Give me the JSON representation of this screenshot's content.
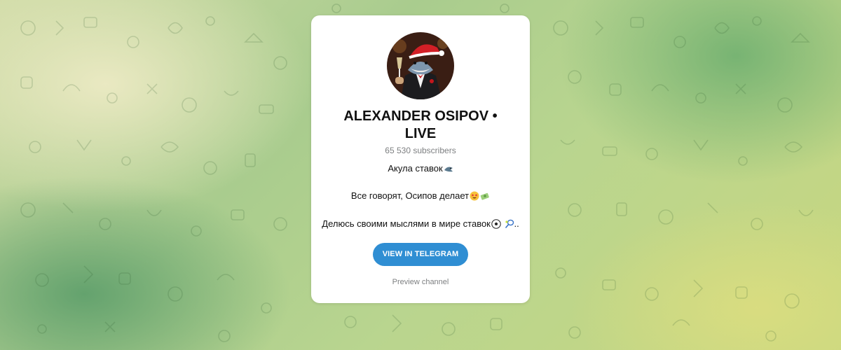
{
  "channel": {
    "title_line1": "ALEXANDER OSIPOV •",
    "title_line2": "LIVE",
    "subscribers": "65 530 subscribers",
    "description_line1": "Акула ставок",
    "description_line2": "Все говорят, Осипов делает",
    "description_line3": "Делюсь своими мыслями в мире ставок",
    "description_line3_suffix": ".."
  },
  "actions": {
    "view_button": "VIEW IN TELEGRAM",
    "preview_link": "Preview channel"
  },
  "icons": {
    "avatar": "shark-in-tuxedo-avatar",
    "d1": "shark-emoji",
    "d2a": "star-struck-emoji",
    "d2b": "money-emoji",
    "d3a": "soccer-ball-emoji",
    "d3b": "tennis-emoji"
  },
  "colors": {
    "accent": "#2f8ed3",
    "muted_text": "#7d7f81",
    "card_bg": "#ffffff"
  }
}
